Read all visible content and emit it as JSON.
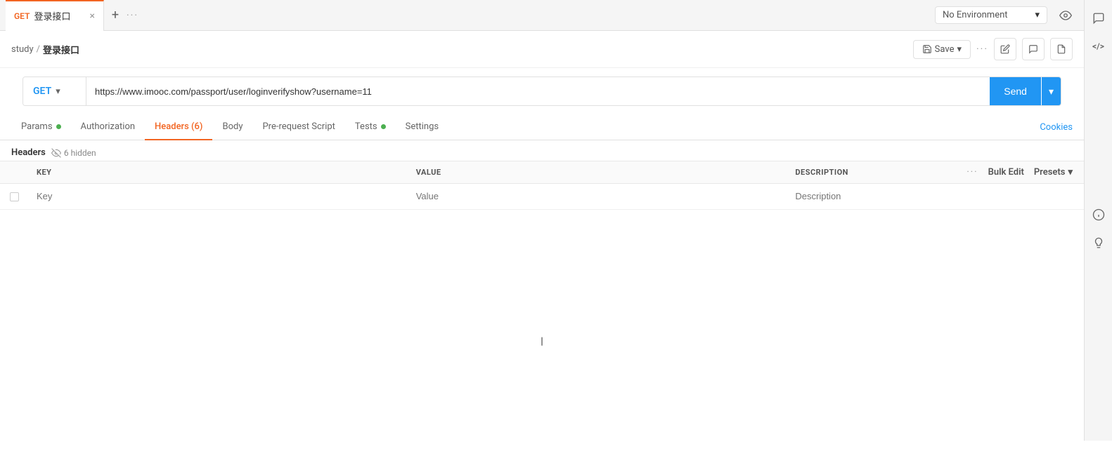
{
  "tab": {
    "method": "GET",
    "name": "登录接口",
    "close_icon": "×"
  },
  "topbar": {
    "add_icon": "+",
    "more_icon": "···",
    "env_label": "No Environment",
    "env_dropdown": "▾",
    "eye_icon": "👁"
  },
  "breadcrumb": {
    "parent": "study",
    "sep": "/",
    "current": "登录接口"
  },
  "toolbar": {
    "save_label": "Save",
    "save_dropdown": "▾",
    "more": "···",
    "edit_icon": "✏",
    "comment_icon": "💬",
    "doc_icon": "📄"
  },
  "url_bar": {
    "method": "GET",
    "method_dropdown": "▾",
    "url": "https://www.imooc.com/passport/user/loginverifyshow?username=11",
    "send_label": "Send",
    "send_dropdown": "▾"
  },
  "tabs": [
    {
      "id": "params",
      "label": "Params",
      "dot": true,
      "active": false
    },
    {
      "id": "auth",
      "label": "Authorization",
      "dot": false,
      "active": false
    },
    {
      "id": "headers",
      "label": "Headers (6)",
      "dot": false,
      "active": true
    },
    {
      "id": "body",
      "label": "Body",
      "dot": false,
      "active": false
    },
    {
      "id": "prerequest",
      "label": "Pre-request Script",
      "dot": false,
      "active": false
    },
    {
      "id": "tests",
      "label": "Tests",
      "dot": true,
      "active": false
    },
    {
      "id": "settings",
      "label": "Settings",
      "dot": false,
      "active": false
    }
  ],
  "cookies_label": "Cookies",
  "headers_section": {
    "title": "Headers",
    "hidden_label": "6 hidden"
  },
  "table": {
    "columns": [
      {
        "id": "key",
        "label": "KEY"
      },
      {
        "id": "value",
        "label": "VALUE"
      },
      {
        "id": "description",
        "label": "DESCRIPTION"
      }
    ],
    "actions": {
      "more": "···",
      "bulk_edit": "Bulk Edit",
      "presets": "Presets",
      "presets_dropdown": "▾"
    },
    "placeholder_row": {
      "key": "Key",
      "value": "Value",
      "description": "Description"
    }
  },
  "right_sidebar": {
    "comment_icon": "💬",
    "code_icon": "</>",
    "info_icon": "ⓘ",
    "lightbulb_icon": "💡"
  }
}
